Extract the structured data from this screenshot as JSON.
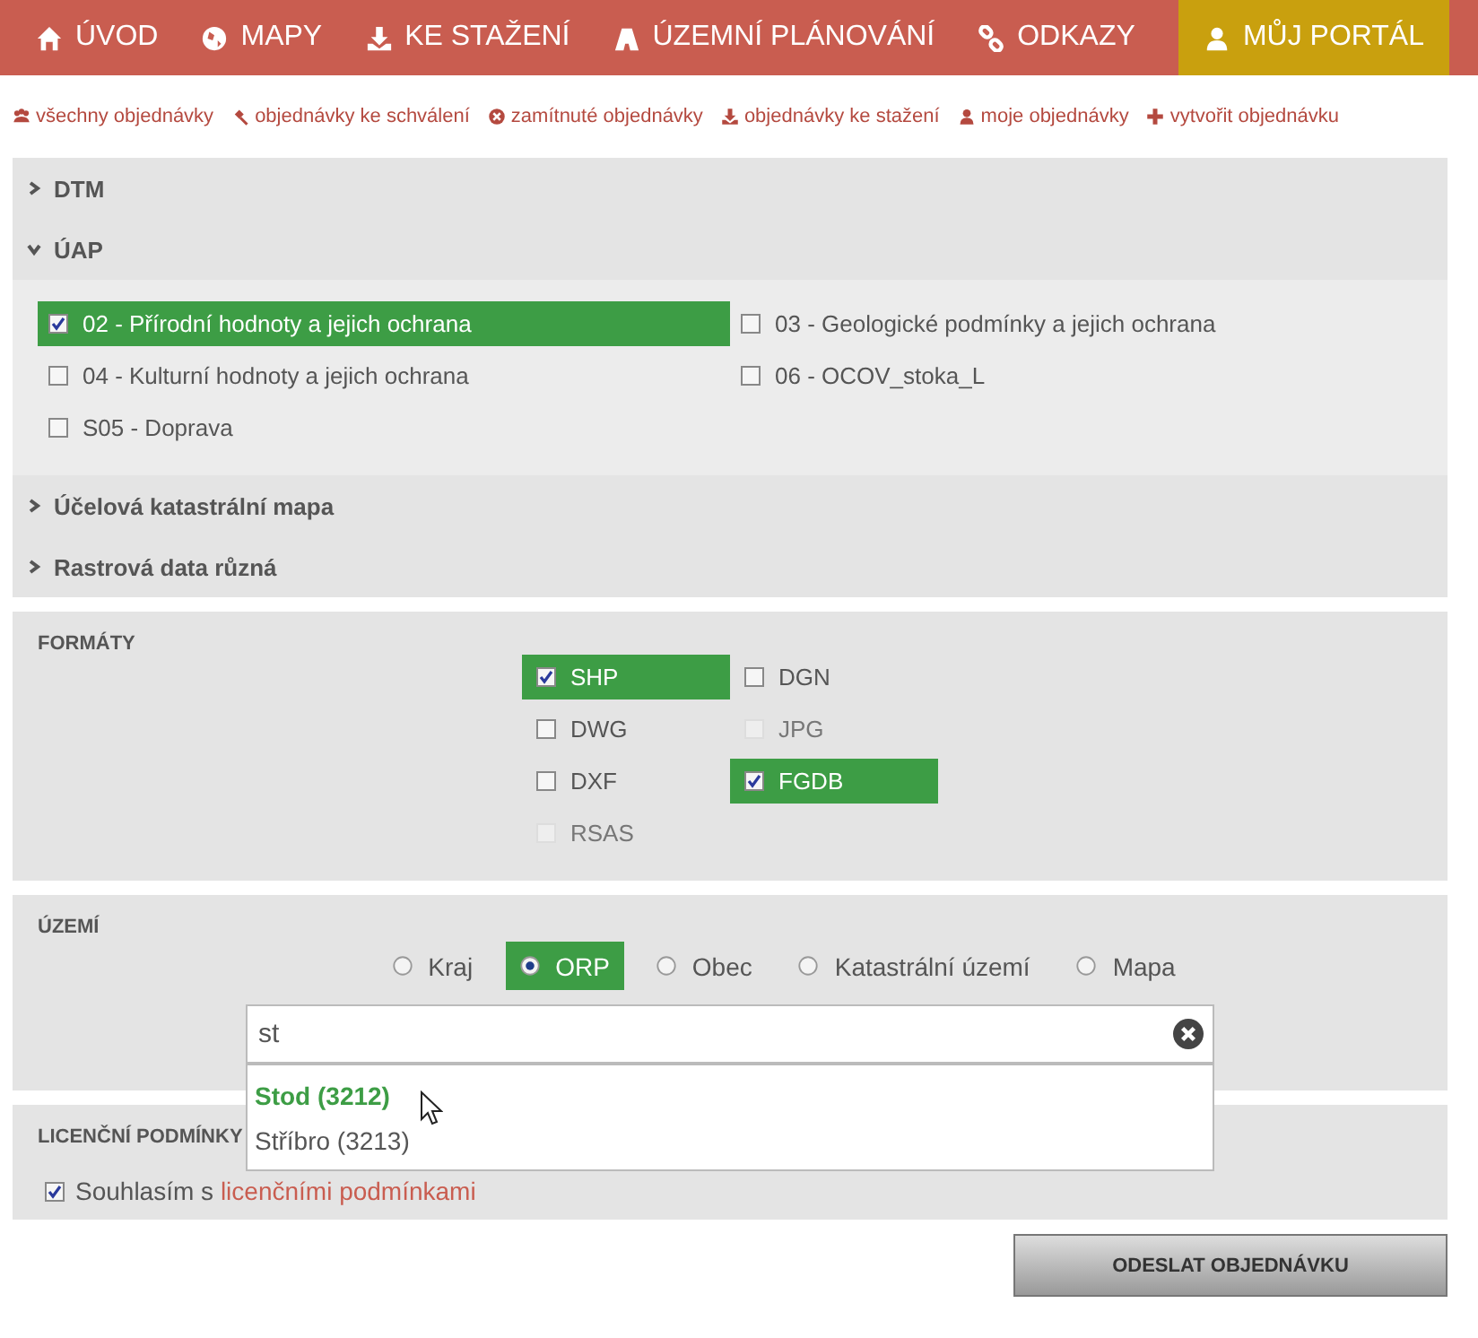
{
  "nav": [
    {
      "label": "ÚVOD",
      "selected": false
    },
    {
      "label": "MAPY",
      "selected": false
    },
    {
      "label": "KE STAŽENÍ",
      "selected": false
    },
    {
      "label": "ÚZEMNÍ PLÁNOVÁNÍ",
      "selected": false
    },
    {
      "label": "ODKAZY",
      "selected": false
    },
    {
      "label": "MŮJ PORTÁL",
      "selected": true
    }
  ],
  "subnav": [
    "všechny objednávky",
    "objednávky ke schválení",
    "zamítnuté objednávky",
    "objednávky ke stažení",
    "moje objednávky",
    "vytvořit objednávku"
  ],
  "layers": [
    {
      "title": "DTM",
      "expanded": false
    },
    {
      "title": "ÚAP",
      "expanded": true,
      "items": [
        {
          "label": "02 - Přírodní hodnoty a jejich ochrana",
          "checked": true
        },
        {
          "label": "03 - Geologické podmínky a jejich ochrana",
          "checked": false
        },
        {
          "label": "04 - Kulturní hodnoty a jejich ochrana",
          "checked": false
        },
        {
          "label": "06 - OCOV_stoka_L",
          "checked": false
        },
        {
          "label": "S05 - Doprava",
          "checked": false
        }
      ]
    },
    {
      "title": "Účelová katastrální mapa",
      "expanded": false
    },
    {
      "title": "Rastrová data různá",
      "expanded": false
    }
  ],
  "formats": {
    "title": "FORMÁTY",
    "items": [
      {
        "label": "SHP",
        "checked": true,
        "disabled": false
      },
      {
        "label": "DGN",
        "checked": false,
        "disabled": false
      },
      {
        "label": "DWG",
        "checked": false,
        "disabled": false
      },
      {
        "label": "JPG",
        "checked": false,
        "disabled": true
      },
      {
        "label": "DXF",
        "checked": false,
        "disabled": false
      },
      {
        "label": "FGDB",
        "checked": true,
        "disabled": false
      },
      {
        "label": "RSAS",
        "checked": false,
        "disabled": true
      }
    ]
  },
  "territory": {
    "title": "ÚZEMÍ",
    "options": [
      {
        "label": "Kraj",
        "selected": false
      },
      {
        "label": "ORP",
        "selected": true
      },
      {
        "label": "Obec",
        "selected": false
      },
      {
        "label": "Katastrální území",
        "selected": false
      },
      {
        "label": "Mapa",
        "selected": false
      }
    ],
    "search": {
      "value": "st"
    },
    "suggestions": [
      {
        "label": "Stod (3212)",
        "selected": true
      },
      {
        "label": "Stříbro (3213)",
        "selected": false
      }
    ]
  },
  "license": {
    "title": "LICENČNÍ PODMÍNKY",
    "checked": true,
    "text": "Souhlasím s",
    "link": "licenčními podmínkami"
  },
  "submit": "ODESLAT OBJEDNÁVKU"
}
